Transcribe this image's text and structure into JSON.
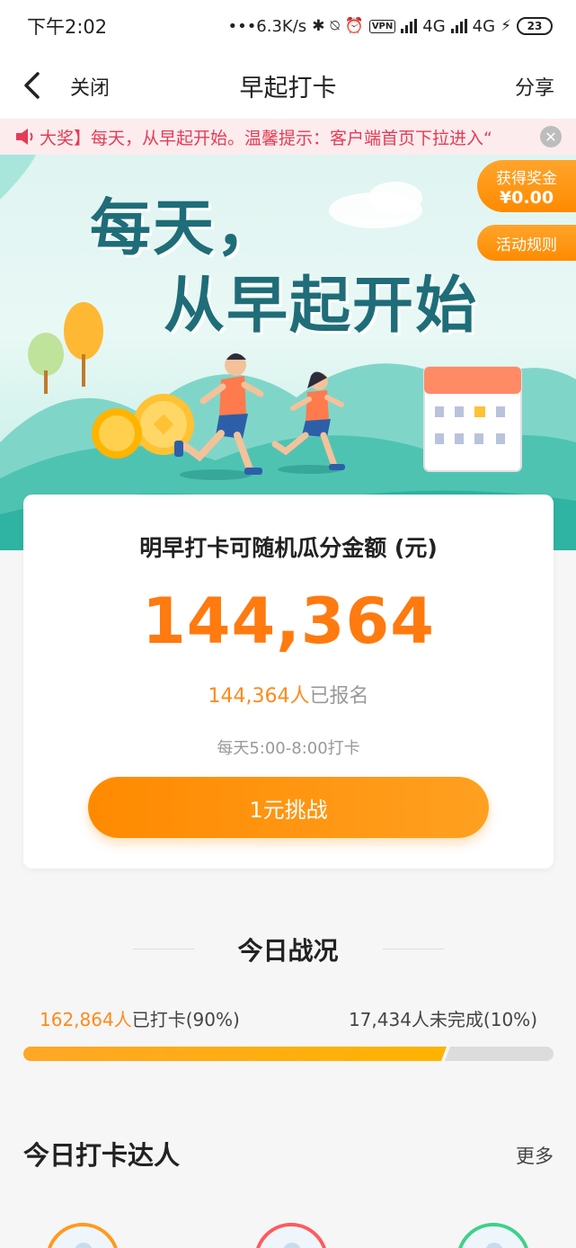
{
  "status_bar": {
    "time": "下午2:02",
    "speed": "•••6.3K/s",
    "net1": "4G",
    "net2": "4G",
    "battery": "23"
  },
  "nav": {
    "close_label": "关闭",
    "title": "早起打卡",
    "share_label": "分享"
  },
  "notice": {
    "text": "大奖】每天，从早起开始。温馨提示：客户端首页下拉进入“",
    "close_symbol": "✕"
  },
  "banner": {
    "title_line1": "每天，",
    "title_line2": "从早起开始",
    "reward_label": "获得奖金",
    "reward_amount": "¥0.00",
    "rules_label": "活动规则"
  },
  "card": {
    "heading": "明早打卡可随机瓜分金额 (元)",
    "pool_amount": "144,364",
    "enrolled_count": "144,364人",
    "enrolled_suffix": "已报名",
    "checkin_time": "每天5:00-8:00打卡",
    "challenge_label": "1元挑战"
  },
  "today": {
    "title": "今日战况",
    "done_count": "162,864人",
    "done_suffix": "已打卡(90%)",
    "undone": "17,434人未完成(10%)",
    "done_fraction": 0.9
  },
  "top_checkin": {
    "title": "今日打卡达人",
    "more_label": "更多"
  },
  "colors": {
    "accent_orange": "#ff7a0f",
    "notice_red": "#e63b54",
    "banner_teal": "#1f6d78"
  }
}
